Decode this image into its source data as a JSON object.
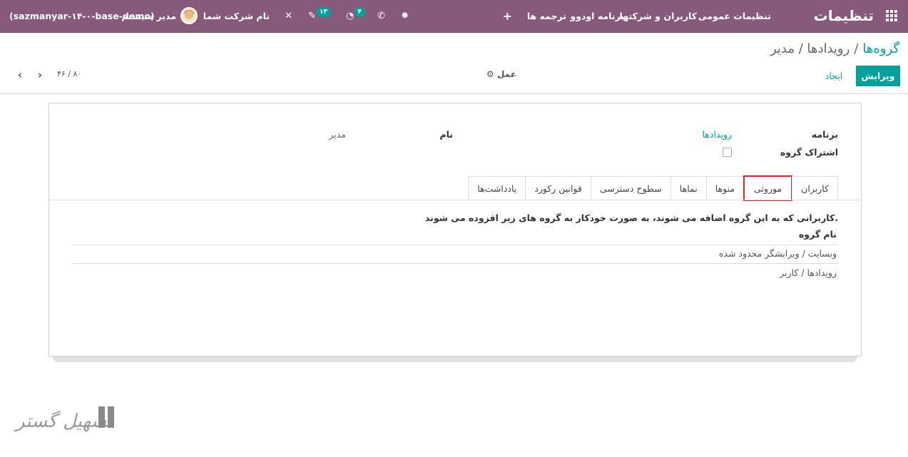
{
  "navbar": {
    "app_title": "تنظیمات",
    "menu": [
      "تنظیمات عمومی",
      "کاربران و شرکتها",
      "برنامه اودوو",
      "ترجمه ها"
    ],
    "plus_icon": "+",
    "bug_icon": "✹",
    "phone_icon": "✆",
    "activity_badge": "۴",
    "activity_icon": "◔",
    "chat_badge": "۱۳",
    "chat_icon": "✎",
    "tools_icon": "✕",
    "company": "نام شرکت شما",
    "user": "مدیر سیستم",
    "database": "(sazmanyar-۱۴-۰-base-demo)"
  },
  "control_panel": {
    "breadcrumb_groups": "گروه‌ها",
    "breadcrumb_current": "رویدادها / مدیر",
    "edit": "ویرایش",
    "create": "ایجاد",
    "action": "⚙ عمل",
    "pager": "۴۶ / ۸۰",
    "prev": "‹",
    "next": "›"
  },
  "form": {
    "application_label": "برنامه",
    "application_value": "رویدادها",
    "name_label": "نام",
    "name_value": "مدیر",
    "share_label": "اشتراک گروه"
  },
  "tabs": [
    "کاربران",
    "موروثی",
    "منوها",
    "نماها",
    "سطوح دسترسی",
    "قوانین رکورد",
    "یادداشت‌ها"
  ],
  "inherited": {
    "description": "کاربرانی که به این گروه اضافه می شوند، به صورت خودکار به گروه های زیر افزوده می شوند.",
    "column_header": "نام گروه",
    "rows": [
      "وبسایت / ویرایشگر محدود شده",
      "رویدادها / کاربر"
    ]
  },
  "watermark": {
    "text": "تسهیل گستر"
  },
  "colors": {
    "navbar": "#875a7b",
    "primary": "#00a09d",
    "active_tab_border": "#e02424"
  }
}
